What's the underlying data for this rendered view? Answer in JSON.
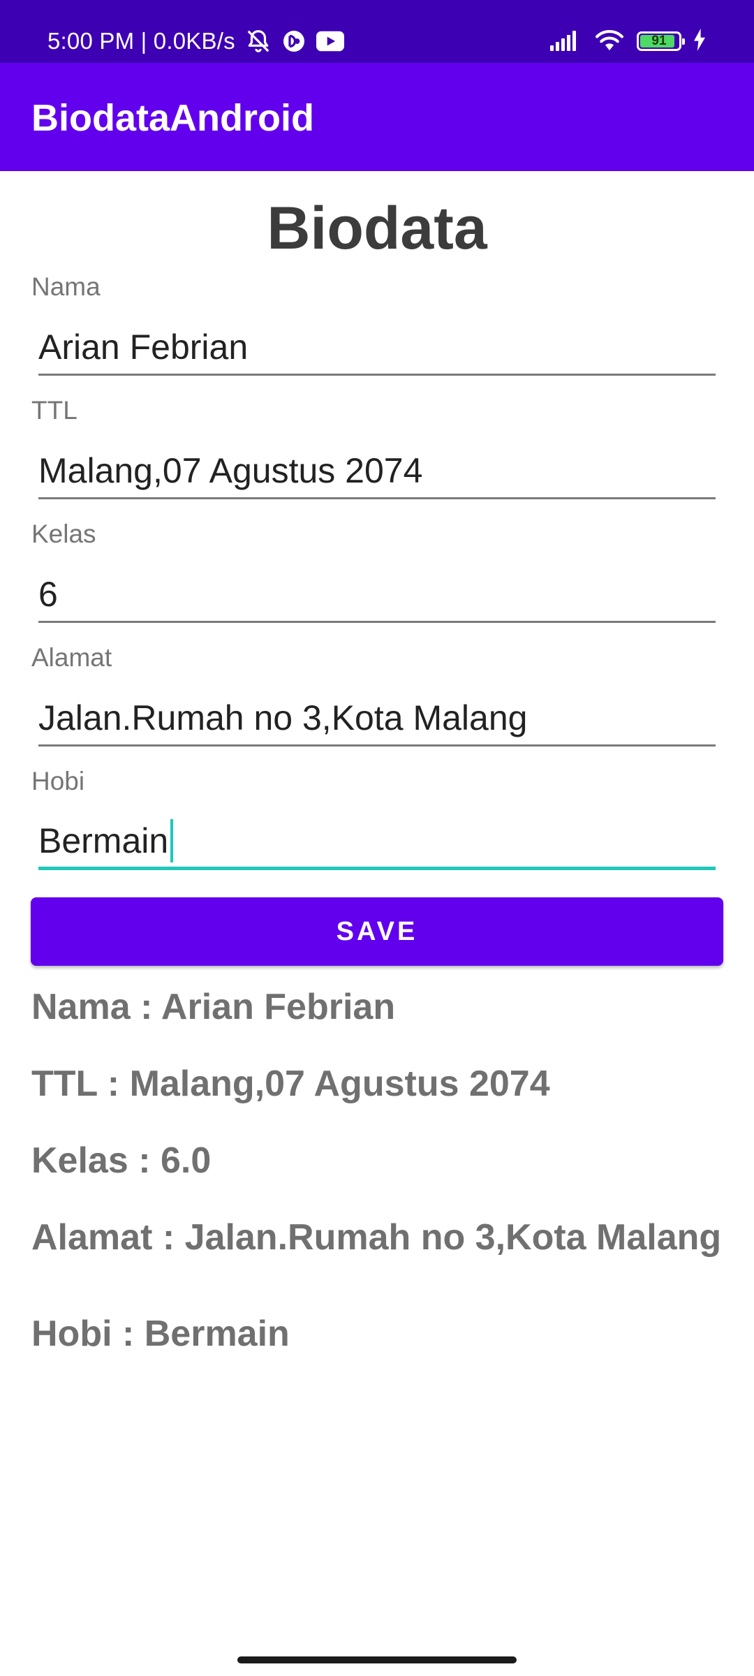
{
  "status_bar": {
    "time_speed": "5:00 PM | 0.0KB/s",
    "left_icons": [
      "bell-muted-icon",
      "app-notification-icon",
      "youtube-icon"
    ],
    "right_icons": [
      "signal-icon",
      "wifi-icon",
      "battery-icon",
      "charging-icon"
    ],
    "battery_level": "91",
    "battery_fraction": 0.91
  },
  "app_bar": {
    "title": "BiodataAndroid"
  },
  "form": {
    "heading": "Biodata",
    "fields": [
      {
        "label": "Nama",
        "value": "Arian Febrian"
      },
      {
        "label": "TTL",
        "value": "Malang,07 Agustus 2074"
      },
      {
        "label": "Kelas",
        "value": "6"
      },
      {
        "label": "Alamat",
        "value": "Jalan.Rumah no 3,Kota Malang"
      },
      {
        "label": "Hobi",
        "value": "Bermain"
      }
    ],
    "save_label": "SAVE"
  },
  "results": [
    "Nama : Arian Febrian",
    "TTL : Malang,07 Agustus 2074",
    "Kelas : 6.0",
    "Alamat : Jalan.Rumah no 3,Kota Malang",
    "Hobi : Bermain"
  ],
  "colors": {
    "status_bar": "#3e00b3",
    "primary": "#6200ee",
    "focus_accent": "#1ec9b9",
    "result_text": "#707070"
  }
}
